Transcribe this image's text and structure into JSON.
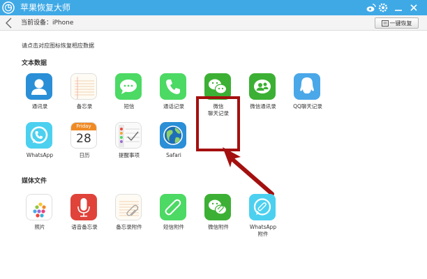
{
  "window": {
    "title": "苹果恢复大师"
  },
  "toolbar": {
    "device_label": "当前设备：iPhone",
    "restore_label": "一键恢复"
  },
  "main": {
    "hint": "请点击对应图标恢复相应数据",
    "sections": [
      {
        "title": "文本数据"
      },
      {
        "title": "媒体文件"
      }
    ],
    "text_items": [
      {
        "label": "通讯录",
        "icon": "contacts-icon"
      },
      {
        "label": "备忘录",
        "icon": "notes-icon"
      },
      {
        "label": "短信",
        "icon": "messages-icon"
      },
      {
        "label": "通话记录",
        "icon": "phone-icon"
      },
      {
        "label": "微信\n聊天记录",
        "icon": "wechat-icon"
      },
      {
        "label": "微信通讯录",
        "icon": "wechat-contacts-icon"
      },
      {
        "label": "QQ聊天记录",
        "icon": "qq-icon"
      },
      {
        "label": "WhatsApp",
        "icon": "whatsapp-icon"
      },
      {
        "label": "日历",
        "icon": "calendar-icon",
        "calendar": {
          "weekday": "Friday",
          "day": "28"
        }
      },
      {
        "label": "提醒事项",
        "icon": "reminders-icon"
      },
      {
        "label": "Safari",
        "icon": "safari-icon"
      }
    ],
    "media_items": [
      {
        "label": "照片",
        "icon": "photos-icon"
      },
      {
        "label": "语音备忘录",
        "icon": "voice-memo-icon"
      },
      {
        "label": "备忘录附件",
        "icon": "notes-attachment-icon"
      },
      {
        "label": "短信附件",
        "icon": "sms-attachment-icon"
      },
      {
        "label": "微信附件",
        "icon": "wechat-attachment-icon"
      },
      {
        "label": "WhatsApp\n附件",
        "icon": "whatsapp-attachment-icon"
      }
    ]
  },
  "colors": {
    "titlebar": "#3fa9e6",
    "highlight": "#a3100f",
    "ios_green": "#4cd964",
    "wechat_green": "#3cb034"
  }
}
